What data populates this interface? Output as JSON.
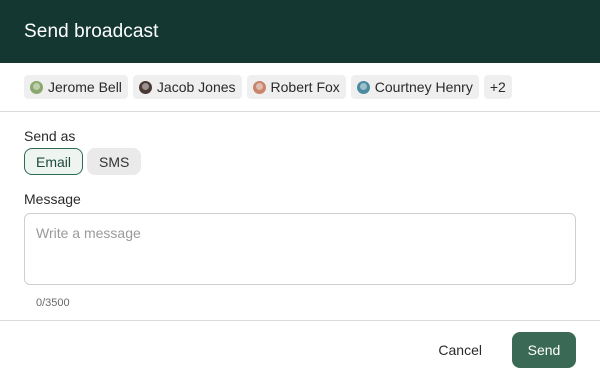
{
  "header": {
    "title": "Send broadcast"
  },
  "recipients": {
    "chips": [
      {
        "name": "Jerome Bell",
        "avatar_color": "#8aa86b"
      },
      {
        "name": "Jacob Jones",
        "avatar_color": "#4a3a36"
      },
      {
        "name": "Robert Fox",
        "avatar_color": "#c9846a"
      },
      {
        "name": "Courtney Henry",
        "avatar_color": "#4c8aa0"
      }
    ],
    "more": "+2"
  },
  "send_as": {
    "label": "Send as",
    "options": [
      "Email",
      "SMS"
    ],
    "selected": "Email"
  },
  "message": {
    "label": "Message",
    "placeholder": "Write a message",
    "value": "",
    "counter": "0/3500"
  },
  "footer": {
    "cancel_label": "Cancel",
    "send_label": "Send"
  },
  "colors": {
    "header_bg": "#143831",
    "primary": "#3a6a56",
    "selected_border": "#2f6a55"
  }
}
